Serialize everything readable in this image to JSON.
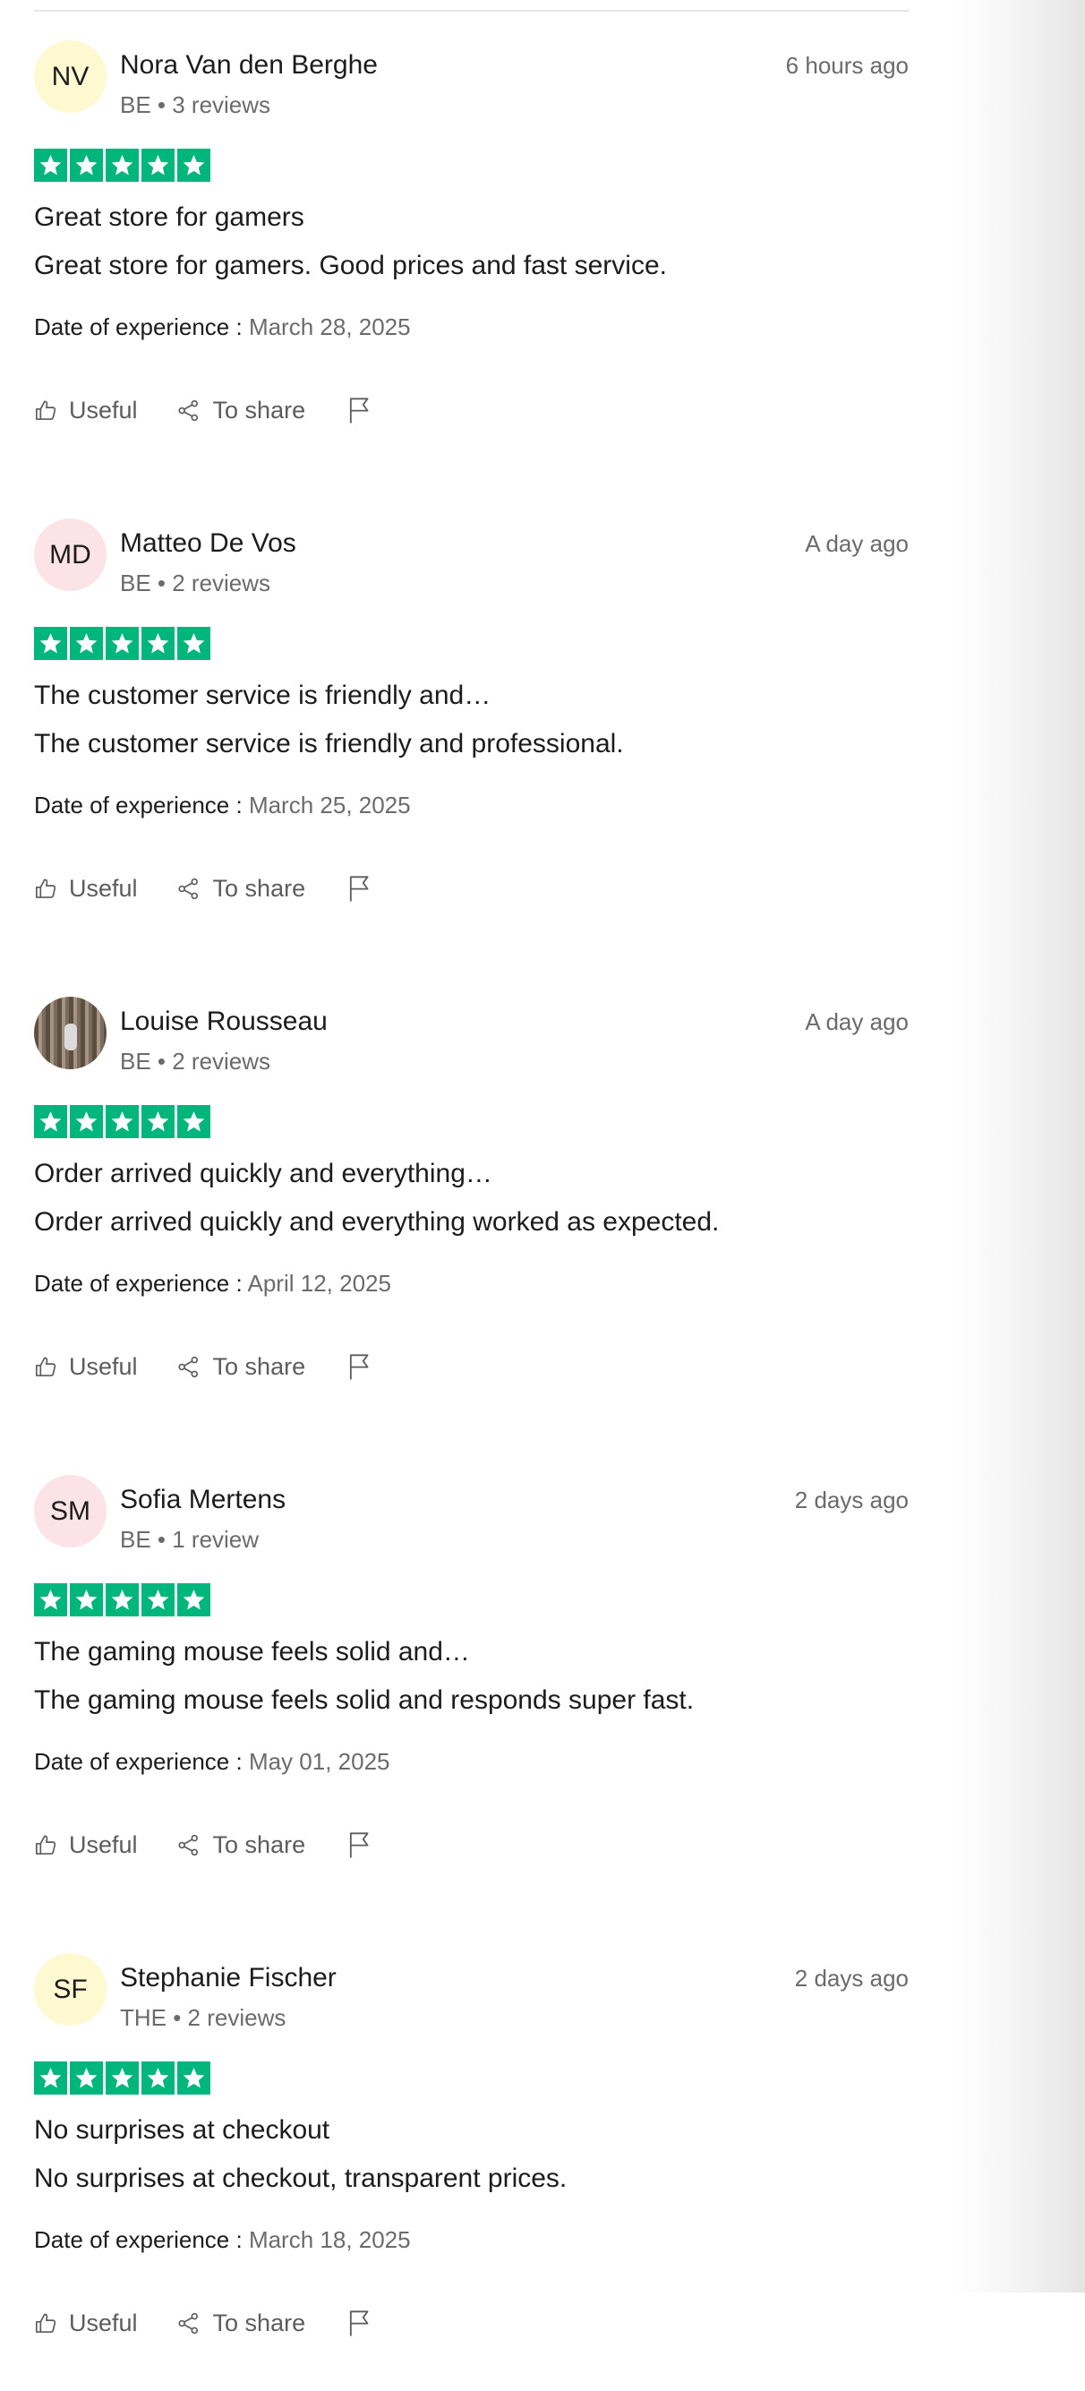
{
  "labels": {
    "date_of_experience": "Date of experience :",
    "useful": "Useful",
    "share": "To share"
  },
  "colors": {
    "star_green": "#00b67a",
    "avatar_yellow": "#fff9d2",
    "avatar_pink": "#fbe3e8"
  },
  "icons": [
    "star-icon",
    "thumbs-up-icon",
    "share-icon",
    "flag-icon"
  ],
  "reviews": [
    {
      "initials": "NV",
      "avatar_color": "#fff9d2",
      "name": "Nora Van den Berghe",
      "meta": "BE • 3 reviews",
      "time": "6 hours ago",
      "rating": 5,
      "title": "Great store for gamers",
      "body": "Great store for gamers. Good prices and fast service.",
      "date": "March 28, 2025"
    },
    {
      "initials": "MD",
      "avatar_color": "#fbe3e8",
      "name": "Matteo De Vos",
      "meta": "BE • 2 reviews",
      "time": "A day ago",
      "rating": 5,
      "title": "The customer service is friendly and…",
      "body": "The customer service is friendly and professional.",
      "date": "March 25, 2025"
    },
    {
      "initials": "",
      "avatar_color": "photo",
      "name": "Louise Rousseau",
      "meta": "BE • 2 reviews",
      "time": "A day ago",
      "rating": 5,
      "title": "Order arrived quickly and everything…",
      "body": "Order arrived quickly and everything worked as expected.",
      "date": "April 12, 2025"
    },
    {
      "initials": "SM",
      "avatar_color": "#fbe3e8",
      "name": "Sofia Mertens",
      "meta": "BE • 1 review",
      "time": "2 days ago",
      "rating": 5,
      "title": "The gaming mouse feels solid and…",
      "body": "The gaming mouse feels solid and responds super fast.",
      "date": "May 01, 2025"
    },
    {
      "initials": "SF",
      "avatar_color": "#fff9d2",
      "name": "Stephanie Fischer",
      "meta": "THE • 2 reviews",
      "time": "2 days ago",
      "rating": 5,
      "title": "No surprises at checkout",
      "body": "No surprises at checkout, transparent prices.",
      "date": "March 18, 2025"
    }
  ]
}
